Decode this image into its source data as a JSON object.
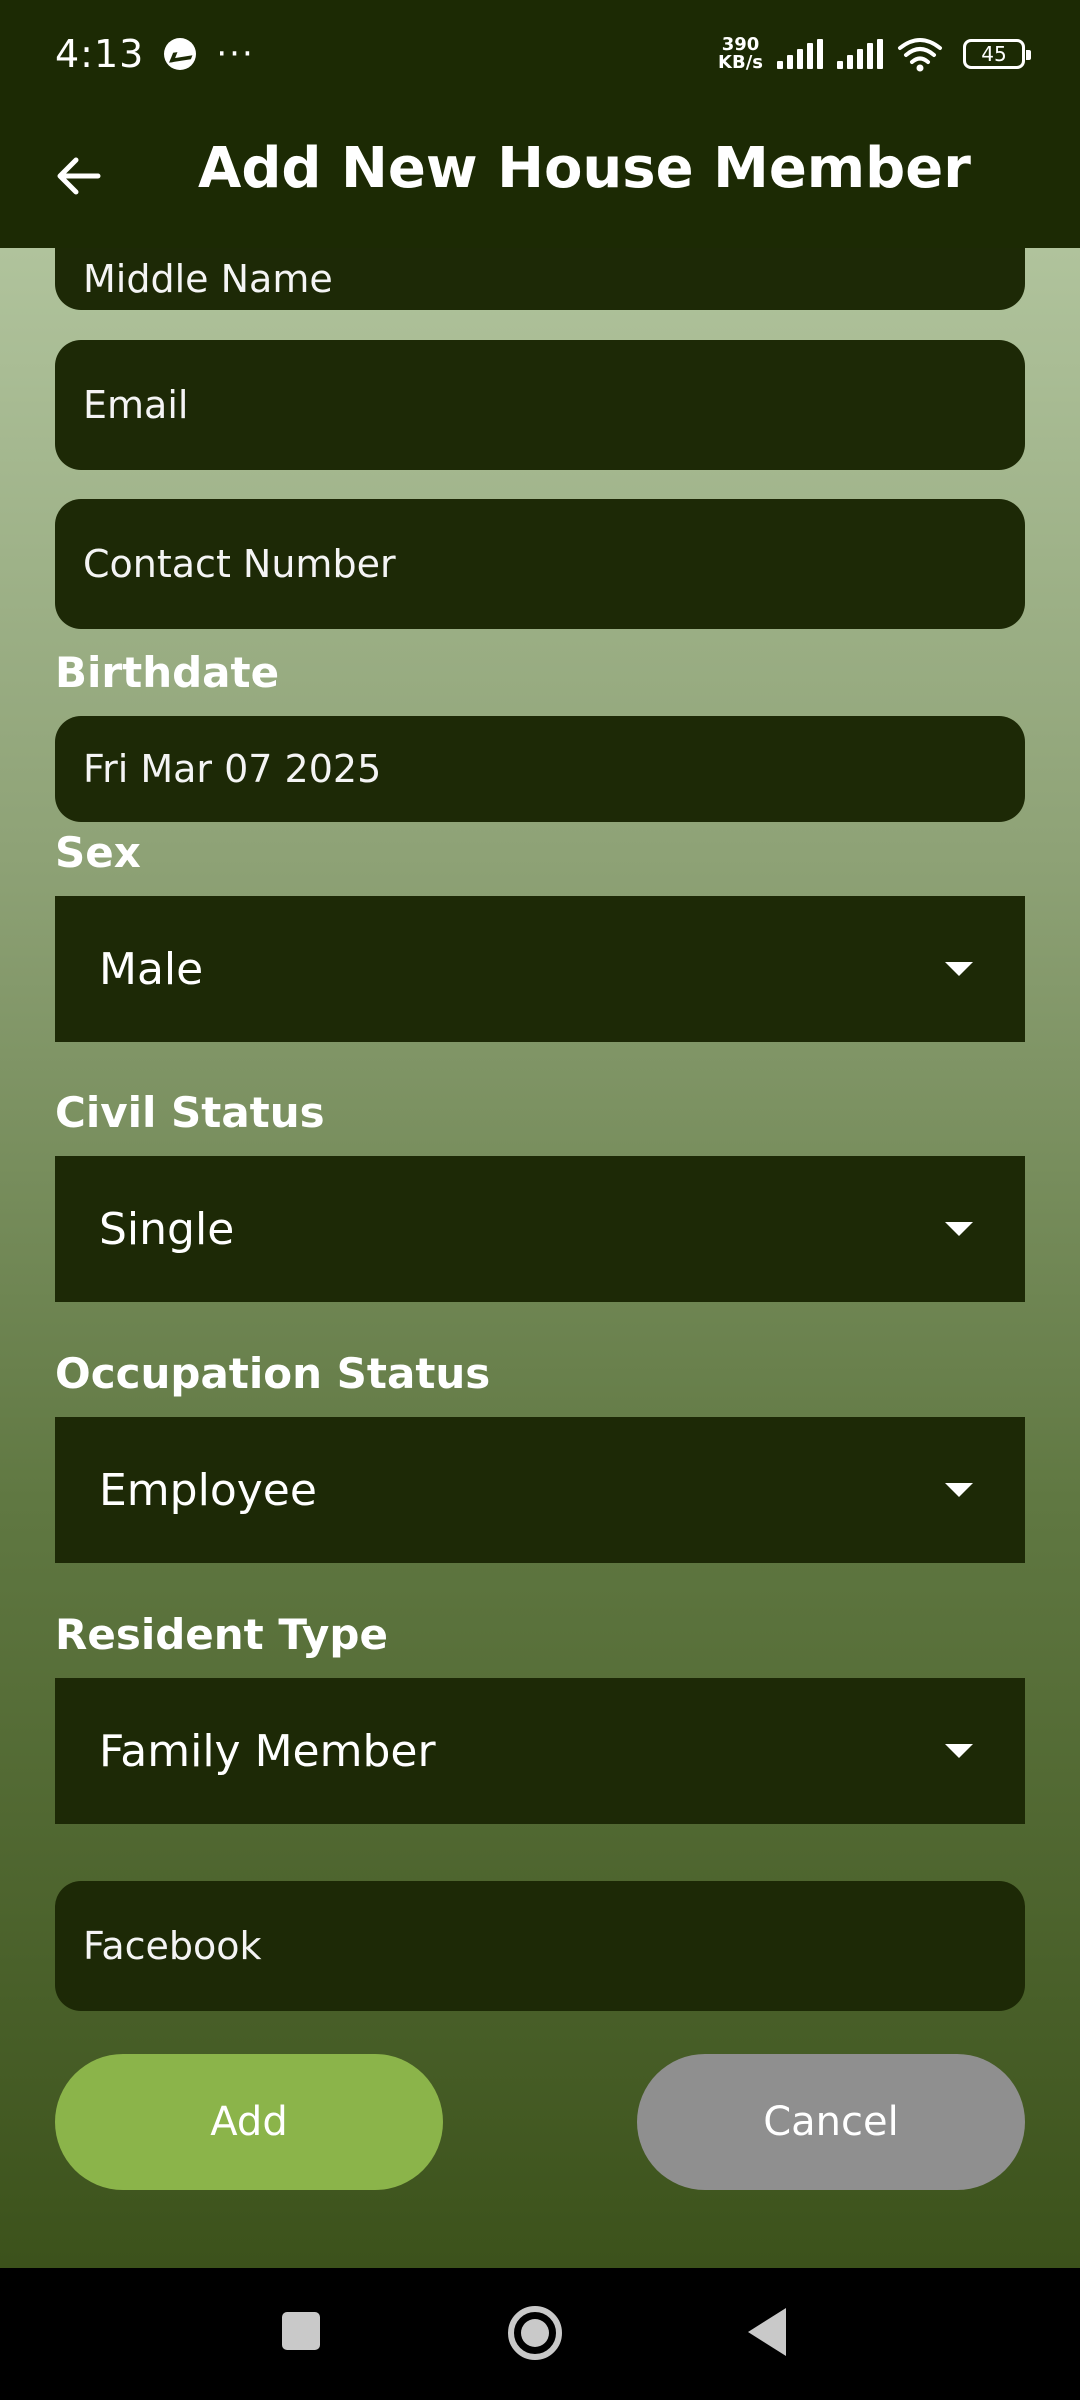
{
  "status_bar": {
    "time": "4:13",
    "overflow": "···",
    "net_speed_value": "390",
    "net_speed_unit": "KB/s",
    "battery": "45",
    "icons": [
      "messenger-icon",
      "signal-icon",
      "signal-icon",
      "wifi-icon",
      "battery-icon"
    ]
  },
  "app_bar": {
    "title": "Add New House Member",
    "back_icon": "arrow-left-icon"
  },
  "form": {
    "middle_name": {
      "placeholder": "Middle Name"
    },
    "email": {
      "placeholder": "Email"
    },
    "contact_number": {
      "placeholder": "Contact Number"
    },
    "birthdate": {
      "label": "Birthdate",
      "value": "Fri Mar 07 2025"
    },
    "sex": {
      "label": "Sex",
      "value": "Male"
    },
    "civil_status": {
      "label": "Civil Status",
      "value": "Single"
    },
    "occupation_status": {
      "label": "Occupation Status",
      "value": "Employee"
    },
    "resident_type": {
      "label": "Resident Type",
      "value": "Family Member"
    },
    "facebook": {
      "placeholder": "Facebook"
    }
  },
  "actions": {
    "add_label": "Add",
    "cancel_label": "Cancel"
  },
  "colors": {
    "bar": "#1c2a04",
    "field": "#1d2906",
    "add_button": "#8bb44a",
    "cancel_button": "#8f8f8f"
  }
}
